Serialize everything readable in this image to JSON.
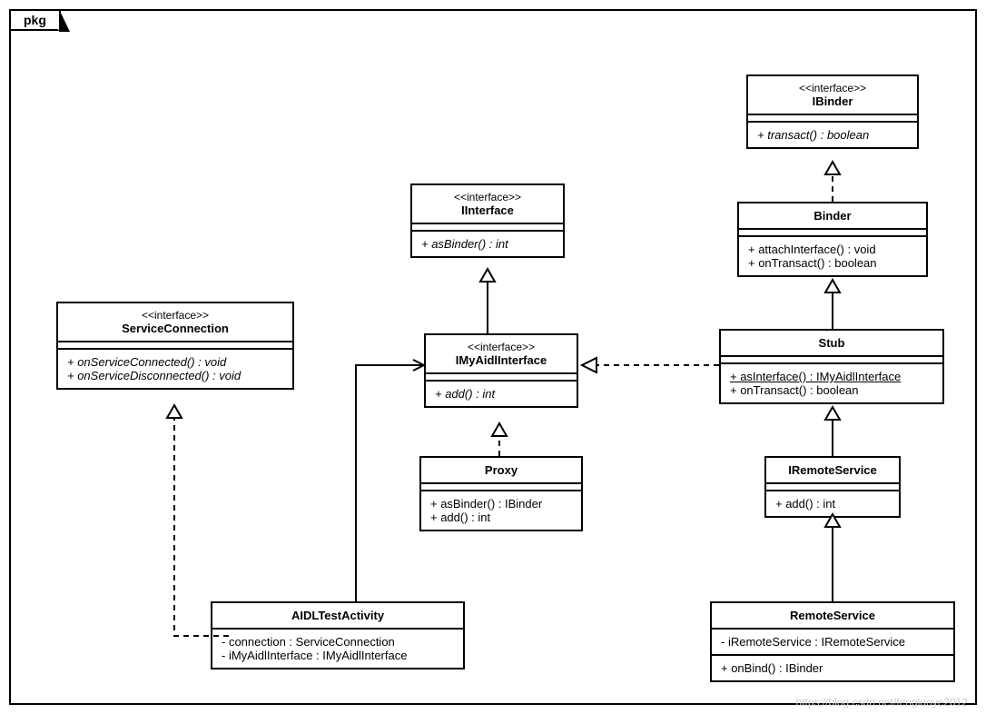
{
  "package_label": "pkg",
  "classes": {
    "serviceConnection": {
      "stereotype": "<<interface>>",
      "name": "ServiceConnection",
      "ops": [
        "+ onServiceConnected() : void",
        "+ onServiceDisconnected() : void"
      ]
    },
    "iInterface": {
      "stereotype": "<<interface>>",
      "name": "IInterface",
      "ops": [
        "+ asBinder() : int"
      ]
    },
    "iBinder": {
      "stereotype": "<<interface>>",
      "name": "IBinder",
      "ops": [
        "+ transact() : boolean"
      ]
    },
    "binder": {
      "name": "Binder",
      "ops": [
        "+ attachInterface() : void",
        "+ onTransact() : boolean"
      ]
    },
    "iMyAidl": {
      "stereotype": "<<interface>>",
      "name": "IMyAidlInterface",
      "ops": [
        "+ add() : int"
      ]
    },
    "stub": {
      "name": "Stub",
      "ops": [
        "+ asInterface() : IMyAidlInterface",
        "+ onTransact() : boolean"
      ]
    },
    "proxy": {
      "name": "Proxy",
      "ops": [
        "+ asBinder() : IBinder",
        "+ add() : int"
      ]
    },
    "iRemoteService": {
      "name": "IRemoteService",
      "ops": [
        "+ add() : int"
      ]
    },
    "aidlTest": {
      "name": "AIDLTestActivity",
      "attrs": [
        "- connection : ServiceConnection",
        "- iMyAidlInterface : IMyAidlInterface"
      ]
    },
    "remoteService": {
      "name": "RemoteService",
      "attrs": [
        "- iRemoteService : IRemoteService"
      ],
      "ops": [
        "+ onBind() : IBinder"
      ]
    }
  },
  "watermark": "https://blog.csdn.net/fengluoye2012",
  "chart_data": {
    "type": "uml_class_diagram",
    "package": "pkg",
    "classes": [
      {
        "id": "ServiceConnection",
        "stereotype": "interface",
        "operations": [
          "onServiceConnected():void",
          "onServiceDisconnected():void"
        ]
      },
      {
        "id": "IInterface",
        "stereotype": "interface",
        "operations": [
          "asBinder():int"
        ]
      },
      {
        "id": "IBinder",
        "stereotype": "interface",
        "operations": [
          "transact():boolean"
        ]
      },
      {
        "id": "Binder",
        "operations": [
          "attachInterface():void",
          "onTransact():boolean"
        ]
      },
      {
        "id": "IMyAidlInterface",
        "stereotype": "interface",
        "operations": [
          "add():int"
        ]
      },
      {
        "id": "Stub",
        "operations": [
          "asInterface():IMyAidlInterface (static)",
          "onTransact():boolean"
        ]
      },
      {
        "id": "Proxy",
        "operations": [
          "asBinder():IBinder",
          "add():int"
        ]
      },
      {
        "id": "IRemoteService",
        "operations": [
          "add():int"
        ]
      },
      {
        "id": "AIDLTestActivity",
        "attributes": [
          "connection:ServiceConnection",
          "iMyAidlInterface:IMyAidlInterface"
        ]
      },
      {
        "id": "RemoteService",
        "attributes": [
          "iRemoteService:IRemoteService"
        ],
        "operations": [
          "onBind():IBinder"
        ]
      }
    ],
    "relations": [
      {
        "from": "IMyAidlInterface",
        "to": "IInterface",
        "type": "generalization"
      },
      {
        "from": "Binder",
        "to": "IBinder",
        "type": "realization"
      },
      {
        "from": "Stub",
        "to": "Binder",
        "type": "generalization"
      },
      {
        "from": "Stub",
        "to": "IMyAidlInterface",
        "type": "realization"
      },
      {
        "from": "Proxy",
        "to": "IMyAidlInterface",
        "type": "realization"
      },
      {
        "from": "IRemoteService",
        "to": "Stub",
        "type": "generalization"
      },
      {
        "from": "RemoteService",
        "to": "IRemoteService",
        "type": "generalization"
      },
      {
        "from": "AIDLTestActivity",
        "to": "ServiceConnection",
        "type": "realization"
      },
      {
        "from": "AIDLTestActivity",
        "to": "IMyAidlInterface",
        "type": "association"
      }
    ]
  }
}
